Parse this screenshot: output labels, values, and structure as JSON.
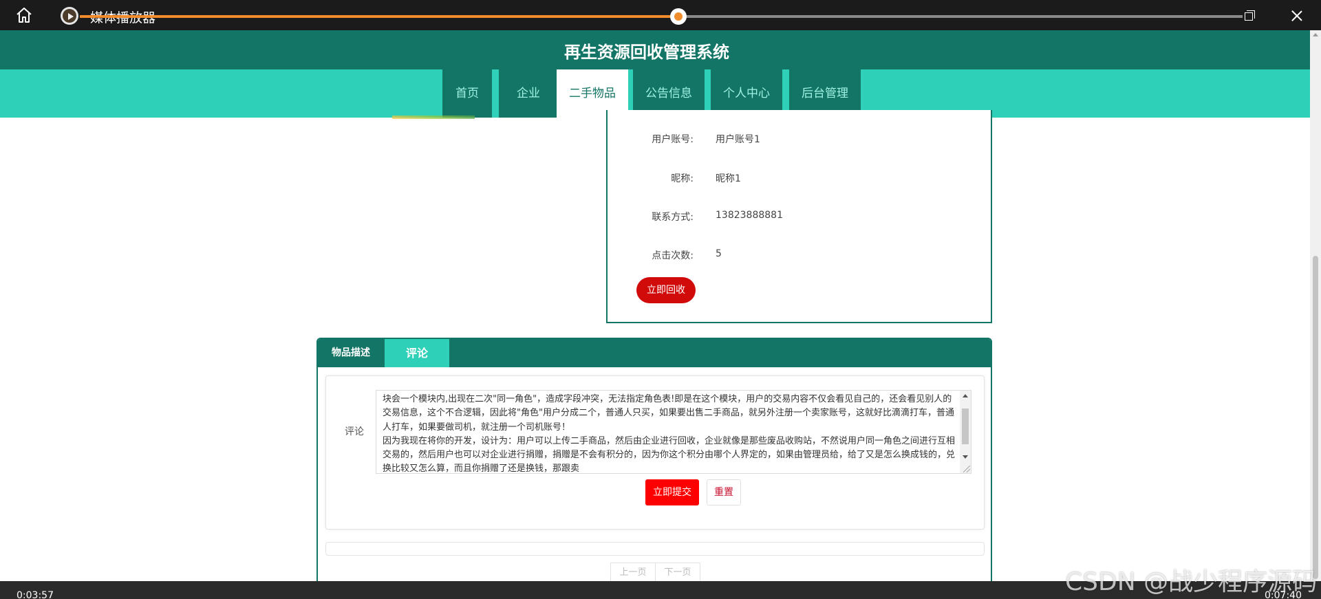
{
  "player": {
    "app_title": "媒体播放器",
    "time_current": "0:03:57",
    "time_total": "0:07:40",
    "progress": 0.515
  },
  "site": {
    "title": "再生资源回收管理系统",
    "nav": [
      "首页",
      "企业",
      "二手物品",
      "公告信息",
      "个人中心",
      "后台管理"
    ],
    "active_nav": "二手物品"
  },
  "info": {
    "rows": [
      {
        "label": "用户账号:",
        "value": "用户账号1"
      },
      {
        "label": "昵称:",
        "value": "昵称1"
      },
      {
        "label": "联系方式:",
        "value": "13823888881"
      },
      {
        "label": "点击次数:",
        "value": "5"
      }
    ],
    "recycle_button": "立即回收"
  },
  "tabs": {
    "items": [
      "物品描述",
      "评论"
    ],
    "active": "评论"
  },
  "comment": {
    "label": "评论",
    "text": "块会一个模块内,出现在二次\"同一角色\"，造成字段冲突，无法指定角色表!即是在这个模块，用户的交易内容不仅会看见自己的，还会看见别人的交易信息，这个不合逻辑，因此将\"角色\"用户分成二个，普通人只买，如果要出售二手商品，就另外注册一个卖家账号，这就好比滴滴打车，普通人打车，如果要做司机，就注册一个司机账号！\n因为我现在将你的开发，设计为：用户可以上传二手商品，然后由企业进行回收，企业就像是那些废品收购站，不然说用户同一角色之间进行互相交易的，然后用户也可以对企业进行捐赠，捐赠是不会有积分的，因为你这个积分由哪个人界定的，如果由管理员给，给了又是怎么换成钱的，兑换比较又怎么算，而且你捐赠了还是换钱，那跟卖",
    "submit": "立即提交",
    "reset": "重置"
  },
  "pager": {
    "prev": "上一页",
    "next": "下一页"
  },
  "watermark": "CSDN @战少程序源码",
  "colors": {
    "header_dark": "#137565",
    "nav_teal": "#2ed1b7",
    "button_red": "#d10a0a",
    "progress_orange": "#f08c2c"
  }
}
